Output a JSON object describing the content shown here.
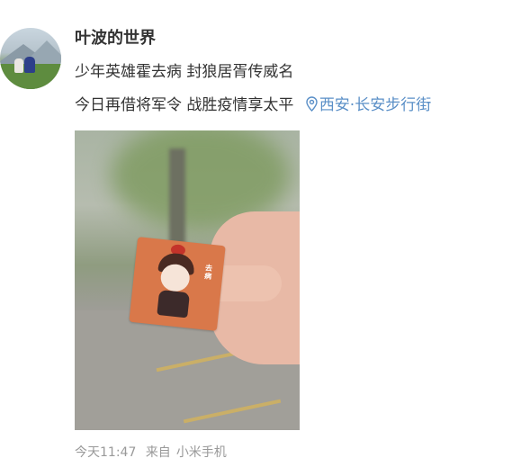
{
  "post": {
    "username": "叶波的世界",
    "text_line1": "少年英雄霍去病 封狼居胥传威名",
    "text_line2": "今日再借将军令 战胜疫情享太平",
    "location": "西安·长安步行街",
    "location_icon": "location-pin-icon",
    "photo": {
      "sticker_text": "去病"
    },
    "time": "今天11:47",
    "source_prefix": "来自",
    "source_device": "小米手机"
  },
  "colors": {
    "text": "#333333",
    "link": "#5a8fc7",
    "meta": "#999999"
  }
}
